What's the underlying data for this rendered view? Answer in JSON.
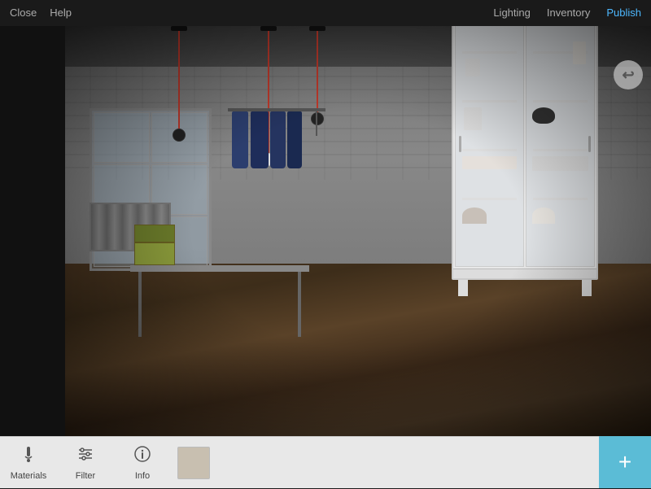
{
  "nav": {
    "left": [
      {
        "id": "close",
        "label": "Close"
      },
      {
        "id": "help",
        "label": "Help"
      }
    ],
    "right": [
      {
        "id": "lighting",
        "label": "Lighting"
      },
      {
        "id": "inventory",
        "label": "Inventory"
      },
      {
        "id": "publish",
        "label": "Publish",
        "active": true
      }
    ]
  },
  "toolbar": {
    "items": [
      {
        "id": "materials",
        "label": "Materials",
        "icon": "🖌"
      },
      {
        "id": "filter",
        "label": "Filter",
        "icon": "⚙"
      },
      {
        "id": "info",
        "label": "Info",
        "icon": "ℹ"
      }
    ],
    "add_label": "+",
    "back_icon": "↩"
  },
  "colors": {
    "nav_bg": "#1a1a1a",
    "toolbar_bg": "#e8e8e8",
    "add_btn": "#5bbcd6",
    "active_nav": "#4db8ff"
  }
}
